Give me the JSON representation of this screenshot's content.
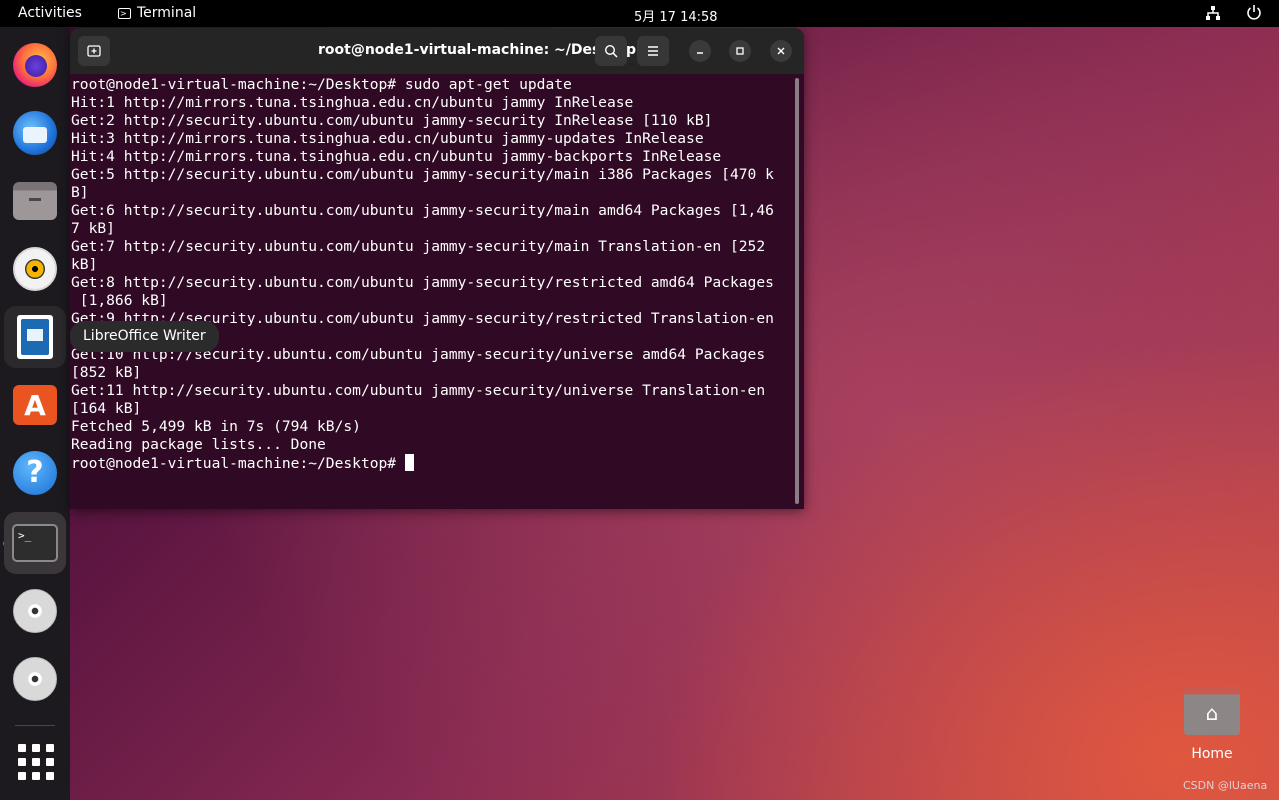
{
  "topbar": {
    "activities": "Activities",
    "app_name": "Terminal",
    "clock": "5月 17  14:58"
  },
  "dock": {
    "tooltip": "LibreOffice Writer",
    "apps": [
      "firefox",
      "thunderbird",
      "files",
      "rhythmbox",
      "libreoffice-writer",
      "app-center",
      "help",
      "terminal",
      "disc-1",
      "disc-2",
      "show-apps"
    ]
  },
  "terminal": {
    "title": "root@node1-virtual-machine: ~/Desktop",
    "lines": [
      "root@node1-virtual-machine:~/Desktop# sudo apt-get update",
      "Hit:1 http://mirrors.tuna.tsinghua.edu.cn/ubuntu jammy InRelease",
      "Get:2 http://security.ubuntu.com/ubuntu jammy-security InRelease [110 kB]",
      "Hit:3 http://mirrors.tuna.tsinghua.edu.cn/ubuntu jammy-updates InRelease",
      "Hit:4 http://mirrors.tuna.tsinghua.edu.cn/ubuntu jammy-backports InRelease",
      "Get:5 http://security.ubuntu.com/ubuntu jammy-security/main i386 Packages [470 k",
      "B]",
      "Get:6 http://security.ubuntu.com/ubuntu jammy-security/main amd64 Packages [1,46",
      "7 kB]",
      "Get:7 http://security.ubuntu.com/ubuntu jammy-security/main Translation-en [252",
      "kB]",
      "Get:8 http://security.ubuntu.com/ubuntu jammy-security/restricted amd64 Packages",
      " [1,866 kB]",
      "Get:9 http://security.ubuntu.com/ubuntu jammy-security/restricted Translation-en",
      "",
      "Get:10 http://security.ubuntu.com/ubuntu jammy-security/universe amd64 Packages",
      "[852 kB]",
      "Get:11 http://security.ubuntu.com/ubuntu jammy-security/universe Translation-en",
      "[164 kB]",
      "Fetched 5,499 kB in 7s (794 kB/s)",
      "Reading package lists... Done"
    ],
    "prompt": "root@node1-virtual-machine:~/Desktop# "
  },
  "desktop": {
    "home_label": "Home",
    "watermark": "CSDN @lUaena"
  },
  "colors": {
    "terminal_bg": "#300a24",
    "accent": "#e95420"
  }
}
